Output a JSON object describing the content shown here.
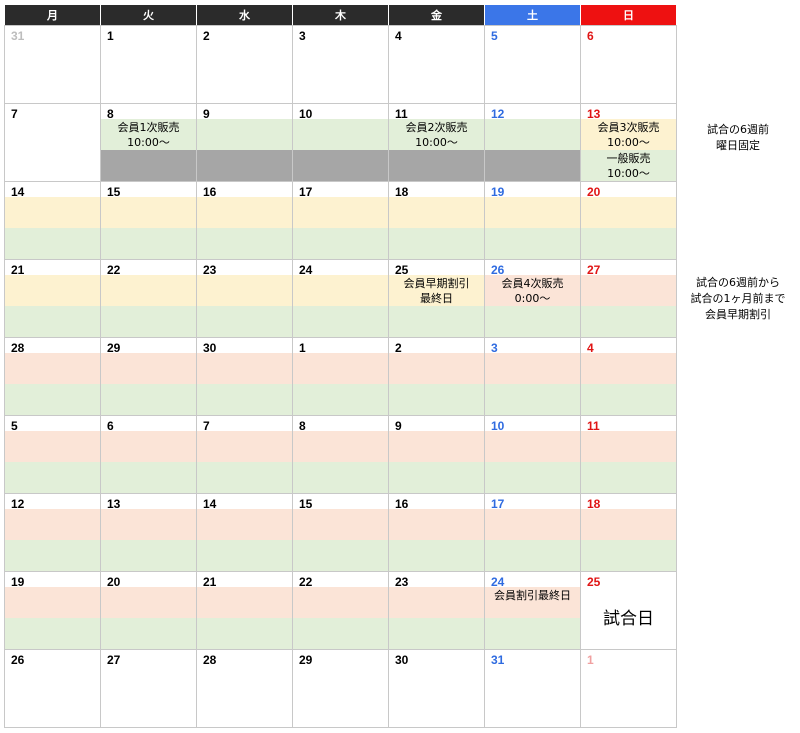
{
  "weekdays": [
    "月",
    "火",
    "水",
    "木",
    "金",
    "土",
    "日"
  ],
  "colors": {
    "header_dark": "#2b2b2b",
    "header_sat": "#3b76e8",
    "header_sun": "#ee1111",
    "band_yellow": "#fdf2d0",
    "band_green": "#e2efd9",
    "band_pink": "#fbe4d7",
    "band_gray": "#a6a6a6"
  },
  "weeks": [
    {
      "days": [
        {
          "num": "31",
          "color": "gray"
        },
        {
          "num": "1"
        },
        {
          "num": "2"
        },
        {
          "num": "3"
        },
        {
          "num": "4"
        },
        {
          "num": "5",
          "color": "blue"
        },
        {
          "num": "6",
          "color": "red"
        }
      ]
    },
    {
      "days": [
        {
          "num": "7"
        },
        {
          "num": "8",
          "band1": "green",
          "band2": "gray",
          "label": "会員1次販売\n10:00〜"
        },
        {
          "num": "9",
          "band1": "green",
          "band2": "gray"
        },
        {
          "num": "10",
          "band1": "green",
          "band2": "gray"
        },
        {
          "num": "11",
          "band1": "green",
          "band2": "gray",
          "label": "会員2次販売\n10:00〜"
        },
        {
          "num": "12",
          "color": "blue",
          "band1": "green",
          "band2": "gray"
        },
        {
          "num": "13",
          "color": "red",
          "band1": "yellow",
          "band2": "green",
          "label": "会員3次販売\n10:00〜",
          "label2": "一般販売\n10:00〜"
        }
      ]
    },
    {
      "days": [
        {
          "num": "14",
          "band1": "yellow",
          "band2": "green"
        },
        {
          "num": "15",
          "band1": "yellow",
          "band2": "green"
        },
        {
          "num": "16",
          "band1": "yellow",
          "band2": "green"
        },
        {
          "num": "17",
          "band1": "yellow",
          "band2": "green"
        },
        {
          "num": "18",
          "band1": "yellow",
          "band2": "green"
        },
        {
          "num": "19",
          "color": "blue",
          "band1": "yellow",
          "band2": "green"
        },
        {
          "num": "20",
          "color": "red",
          "band1": "yellow",
          "band2": "green"
        }
      ]
    },
    {
      "days": [
        {
          "num": "21",
          "band1": "yellow",
          "band2": "green"
        },
        {
          "num": "22",
          "band1": "yellow",
          "band2": "green"
        },
        {
          "num": "23",
          "band1": "yellow",
          "band2": "green"
        },
        {
          "num": "24",
          "band1": "yellow",
          "band2": "green"
        },
        {
          "num": "25",
          "band1": "yellow",
          "band2": "green",
          "label": "会員早期割引\n最終日"
        },
        {
          "num": "26",
          "color": "blue",
          "band1": "pink",
          "band2": "green",
          "label": "会員4次販売\n0:00〜"
        },
        {
          "num": "27",
          "color": "red",
          "band1": "pink",
          "band2": "green"
        }
      ]
    },
    {
      "days": [
        {
          "num": "28",
          "band1": "pink",
          "band2": "green"
        },
        {
          "num": "29",
          "band1": "pink",
          "band2": "green"
        },
        {
          "num": "30",
          "band1": "pink",
          "band2": "green"
        },
        {
          "num": "1",
          "band1": "pink",
          "band2": "green"
        },
        {
          "num": "2",
          "band1": "pink",
          "band2": "green"
        },
        {
          "num": "3",
          "color": "blue",
          "band1": "pink",
          "band2": "green"
        },
        {
          "num": "4",
          "color": "red",
          "band1": "pink",
          "band2": "green"
        }
      ]
    },
    {
      "days": [
        {
          "num": "5",
          "band1": "pink",
          "band2": "green"
        },
        {
          "num": "6",
          "band1": "pink",
          "band2": "green"
        },
        {
          "num": "7",
          "band1": "pink",
          "band2": "green"
        },
        {
          "num": "8",
          "band1": "pink",
          "band2": "green"
        },
        {
          "num": "9",
          "band1": "pink",
          "band2": "green"
        },
        {
          "num": "10",
          "color": "blue",
          "band1": "pink",
          "band2": "green"
        },
        {
          "num": "11",
          "color": "red",
          "band1": "pink",
          "band2": "green"
        }
      ]
    },
    {
      "days": [
        {
          "num": "12",
          "band1": "pink",
          "band2": "green"
        },
        {
          "num": "13",
          "band1": "pink",
          "band2": "green"
        },
        {
          "num": "14",
          "band1": "pink",
          "band2": "green"
        },
        {
          "num": "15",
          "band1": "pink",
          "band2": "green"
        },
        {
          "num": "16",
          "band1": "pink",
          "band2": "green"
        },
        {
          "num": "17",
          "color": "blue",
          "band1": "pink",
          "band2": "green"
        },
        {
          "num": "18",
          "color": "red",
          "band1": "pink",
          "band2": "green"
        }
      ]
    },
    {
      "days": [
        {
          "num": "19",
          "band1": "pink",
          "band2": "green"
        },
        {
          "num": "20",
          "band1": "pink",
          "band2": "green"
        },
        {
          "num": "21",
          "band1": "pink",
          "band2": "green"
        },
        {
          "num": "22",
          "band1": "pink",
          "band2": "green"
        },
        {
          "num": "23",
          "band1": "pink",
          "band2": "green"
        },
        {
          "num": "24",
          "color": "blue",
          "band1": "pink",
          "band2": "green",
          "label": "会員割引最終日"
        },
        {
          "num": "25",
          "color": "red",
          "big": "試合日"
        }
      ]
    },
    {
      "days": [
        {
          "num": "26"
        },
        {
          "num": "27"
        },
        {
          "num": "28"
        },
        {
          "num": "29"
        },
        {
          "num": "30"
        },
        {
          "num": "31",
          "color": "blue"
        },
        {
          "num": "1",
          "color": "pink"
        }
      ]
    }
  ],
  "notes": [
    "試合の6週前\n曜日固定",
    "試合の6週前から\n試合の1ヶ月前まで\n会員早期割引"
  ]
}
